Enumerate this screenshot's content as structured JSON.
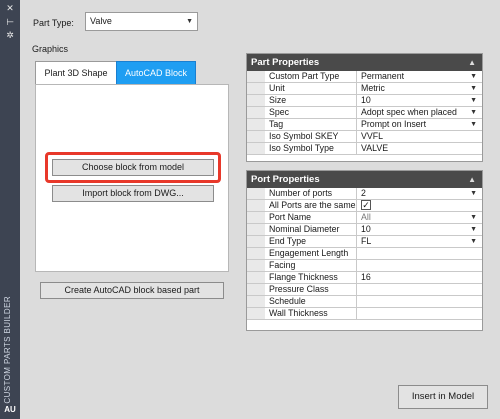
{
  "sidebar": {
    "title": "CUSTOM PARTS BUILDER",
    "icons": [
      "pin-icon",
      "dock-icon",
      "settings-icon"
    ],
    "logo": "AU"
  },
  "part_type": {
    "label": "Part Type:",
    "value": "Valve"
  },
  "graphics": {
    "label": "Graphics",
    "tabs": [
      {
        "label": "Plant 3D Shape",
        "active": false
      },
      {
        "label": "AutoCAD Block",
        "active": true
      }
    ],
    "choose_button": "Choose block from model",
    "import_button": "Import block from DWG...",
    "create_button": "Create AutoCAD block based part"
  },
  "part_properties": {
    "title": "Part Properties",
    "rows": [
      {
        "name": "Custom Part Type",
        "value": "Permanent",
        "dropdown": true
      },
      {
        "name": "Unit",
        "value": "Metric",
        "dropdown": true
      },
      {
        "name": "Size",
        "value": "10",
        "dropdown": true
      },
      {
        "name": "Spec",
        "value": "Adopt spec when placed",
        "dropdown": true
      },
      {
        "name": "Tag",
        "value": "Prompt on Insert",
        "dropdown": true
      },
      {
        "name": "Iso Symbol SKEY",
        "value": "VVFL",
        "dropdown": false
      },
      {
        "name": "Iso Symbol Type",
        "value": "VALVE",
        "dropdown": false
      }
    ]
  },
  "port_properties": {
    "title": "Port Properties",
    "rows": [
      {
        "name": "Number of ports",
        "value": "2",
        "dropdown": true
      },
      {
        "name": "All Ports are the same",
        "value": "✓",
        "checkbox": true
      },
      {
        "name": "Port Name",
        "value": "All",
        "dropdown": true,
        "disabled": true
      },
      {
        "name": "Nominal Diameter",
        "value": "10",
        "dropdown": true
      },
      {
        "name": "End Type",
        "value": "FL",
        "dropdown": true
      },
      {
        "name": "Engagement Length",
        "value": ""
      },
      {
        "name": "Facing",
        "value": ""
      },
      {
        "name": "Flange Thickness",
        "value": "16"
      },
      {
        "name": "Pressure Class",
        "value": ""
      },
      {
        "name": "Schedule",
        "value": ""
      },
      {
        "name": "Wall Thickness",
        "value": ""
      }
    ]
  },
  "insert_button": "Insert in Model",
  "colors": {
    "active_tab": "#1f9ef2",
    "highlight": "#e8382a",
    "grid_header": "#4a4a4a",
    "sidebar": "#3d4452"
  }
}
